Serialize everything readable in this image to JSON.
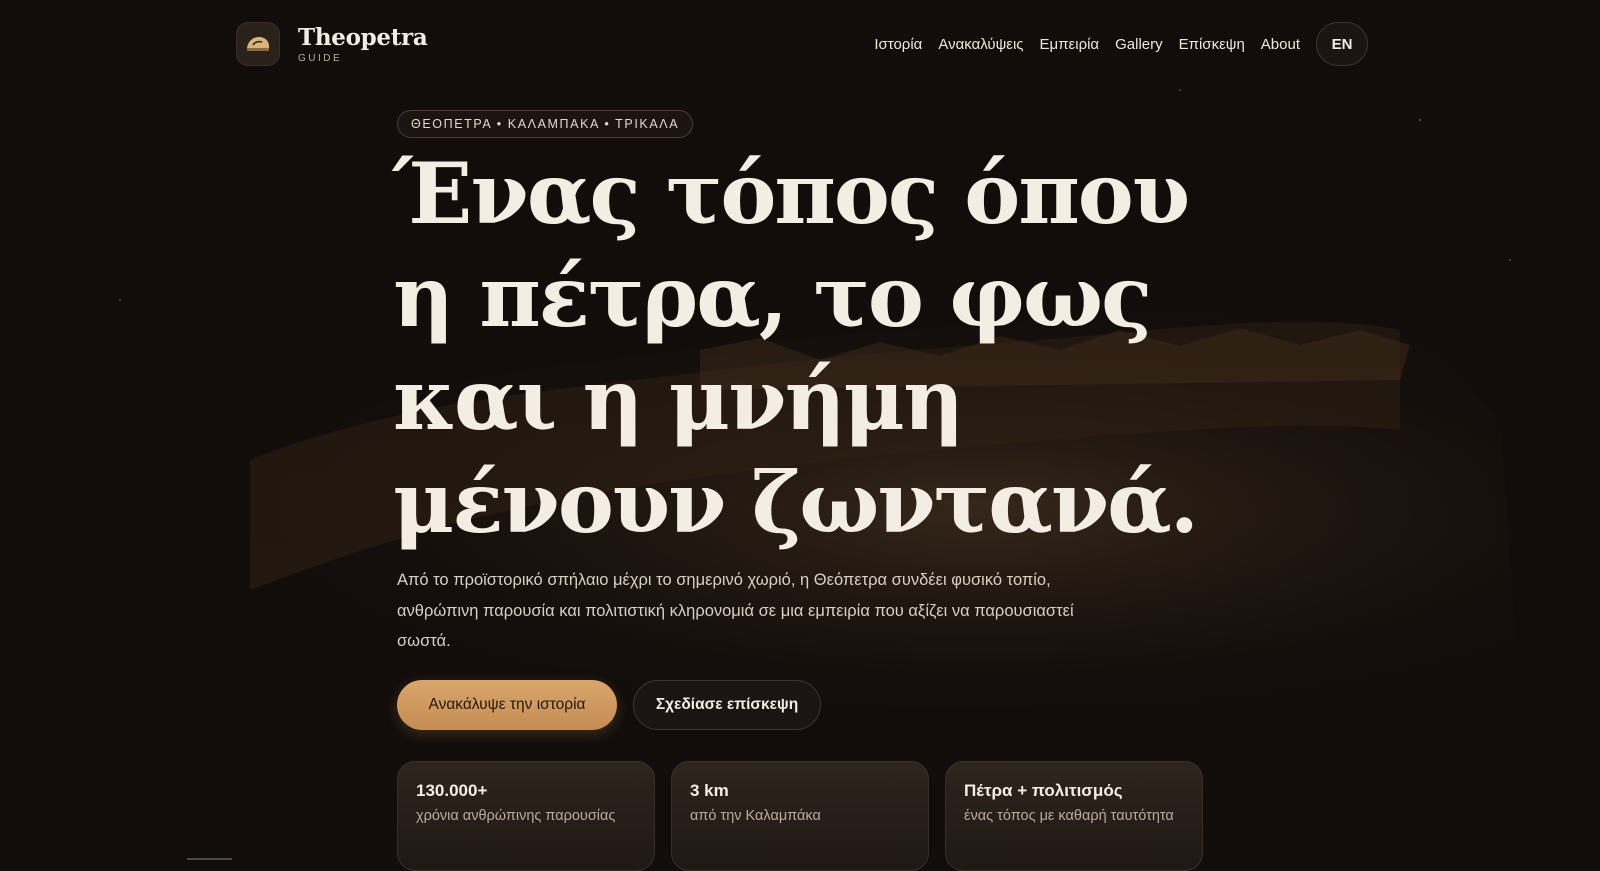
{
  "brand": {
    "name": "Theopetra",
    "sub": "GUIDE"
  },
  "nav": {
    "links": [
      "Ιστορία",
      "Ανακαλύψεις",
      "Εμπειρία",
      "Gallery",
      "Επίσκεψη",
      "About"
    ],
    "lang": "EN"
  },
  "hero": {
    "eyebrow": "ΘΕΟΠΕΤΡΑ • ΚΑΛΑΜΠΑΚΑ • ΤΡΙΚΑΛΑ",
    "headline_lines": [
      "Ένας τόπος όπου",
      "η πέτρα, το φως",
      "και η μνήμη",
      "μένουν ζωντανά."
    ],
    "lead": "Από το προϊστορικό σπήλαιο μέχρι το σημερινό χωριό, η Θεόπετρα συνδέει φυσικό τοπίο, ανθρώπινη παρουσία και πολιτιστική κληρονομιά σε μια εμπειρία που αξίζει να παρουσιαστεί σωστά.",
    "primary_cta": "Ανακάλυψε την ιστορία",
    "secondary_cta": "Σχεδίασε επίσκεψη"
  },
  "stats": [
    {
      "title": "130.000+",
      "sub": "χρόνια ανθρώπινης παρουσίας"
    },
    {
      "title": "3 km",
      "sub": "από την Καλαμπάκα"
    },
    {
      "title": "Πέτρα + πολιτισμός",
      "sub": "ένας τόπος με καθαρή ταυτότητα"
    }
  ],
  "icons": {
    "logo": "cave-rock-icon"
  },
  "colors": {
    "background": "#120d0b",
    "accent": "#d9a66d",
    "text": "#f3ece2"
  }
}
